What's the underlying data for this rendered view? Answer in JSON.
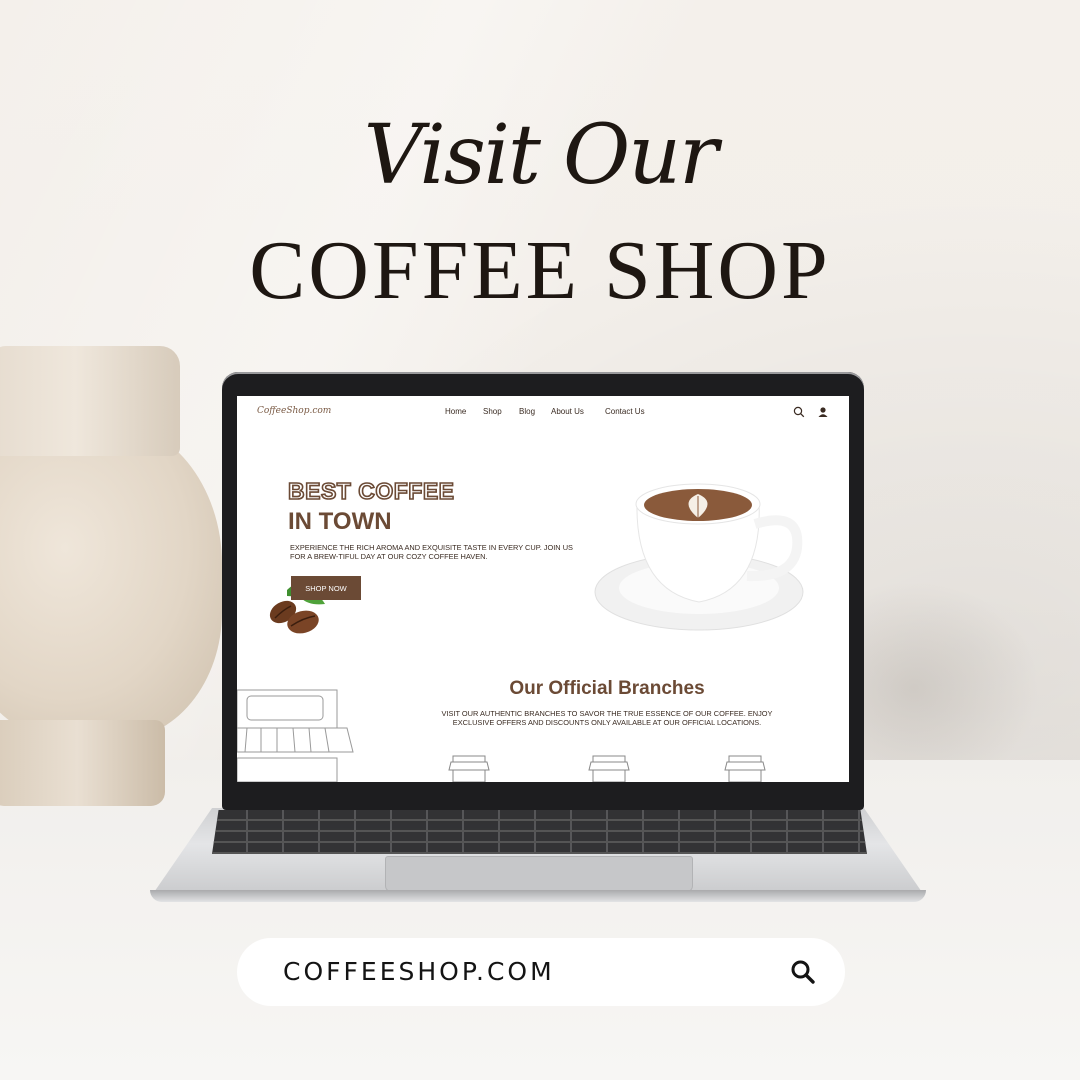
{
  "poster": {
    "heading_script": "Visit Our",
    "heading_main": "COFFEE SHOP"
  },
  "website": {
    "logo": "CoffeeShop.com",
    "nav": [
      "Home",
      "Shop",
      "Blog",
      "About Us",
      "Contact Us"
    ],
    "icons": [
      "search-icon",
      "user-icon"
    ],
    "hero": {
      "title_line1": "BEST COFFEE",
      "title_line2": "IN TOWN",
      "subtitle": "EXPERIENCE THE RICH AROMA AND EXQUISITE TASTE IN EVERY CUP. JOIN US FOR A BREW-TIFUL DAY AT OUR COZY COFFEE HAVEN.",
      "button": "SHOP NOW"
    },
    "branches": {
      "title": "Our Official Branches",
      "subtitle": "VISIT OUR AUTHENTIC BRANCHES TO SAVOR THE TRUE ESSENCE OF OUR COFFEE. ENJOY EXCLUSIVE OFFERS AND DISCOUNTS ONLY AVAILABLE AT OUR OFFICIAL LOCATIONS."
    },
    "colors": {
      "brand_brown": "#6b4a35",
      "text_dark": "#3a2b22"
    }
  },
  "url_bar": {
    "text": "COFFEESHOP.COM",
    "icon": "search-icon"
  }
}
